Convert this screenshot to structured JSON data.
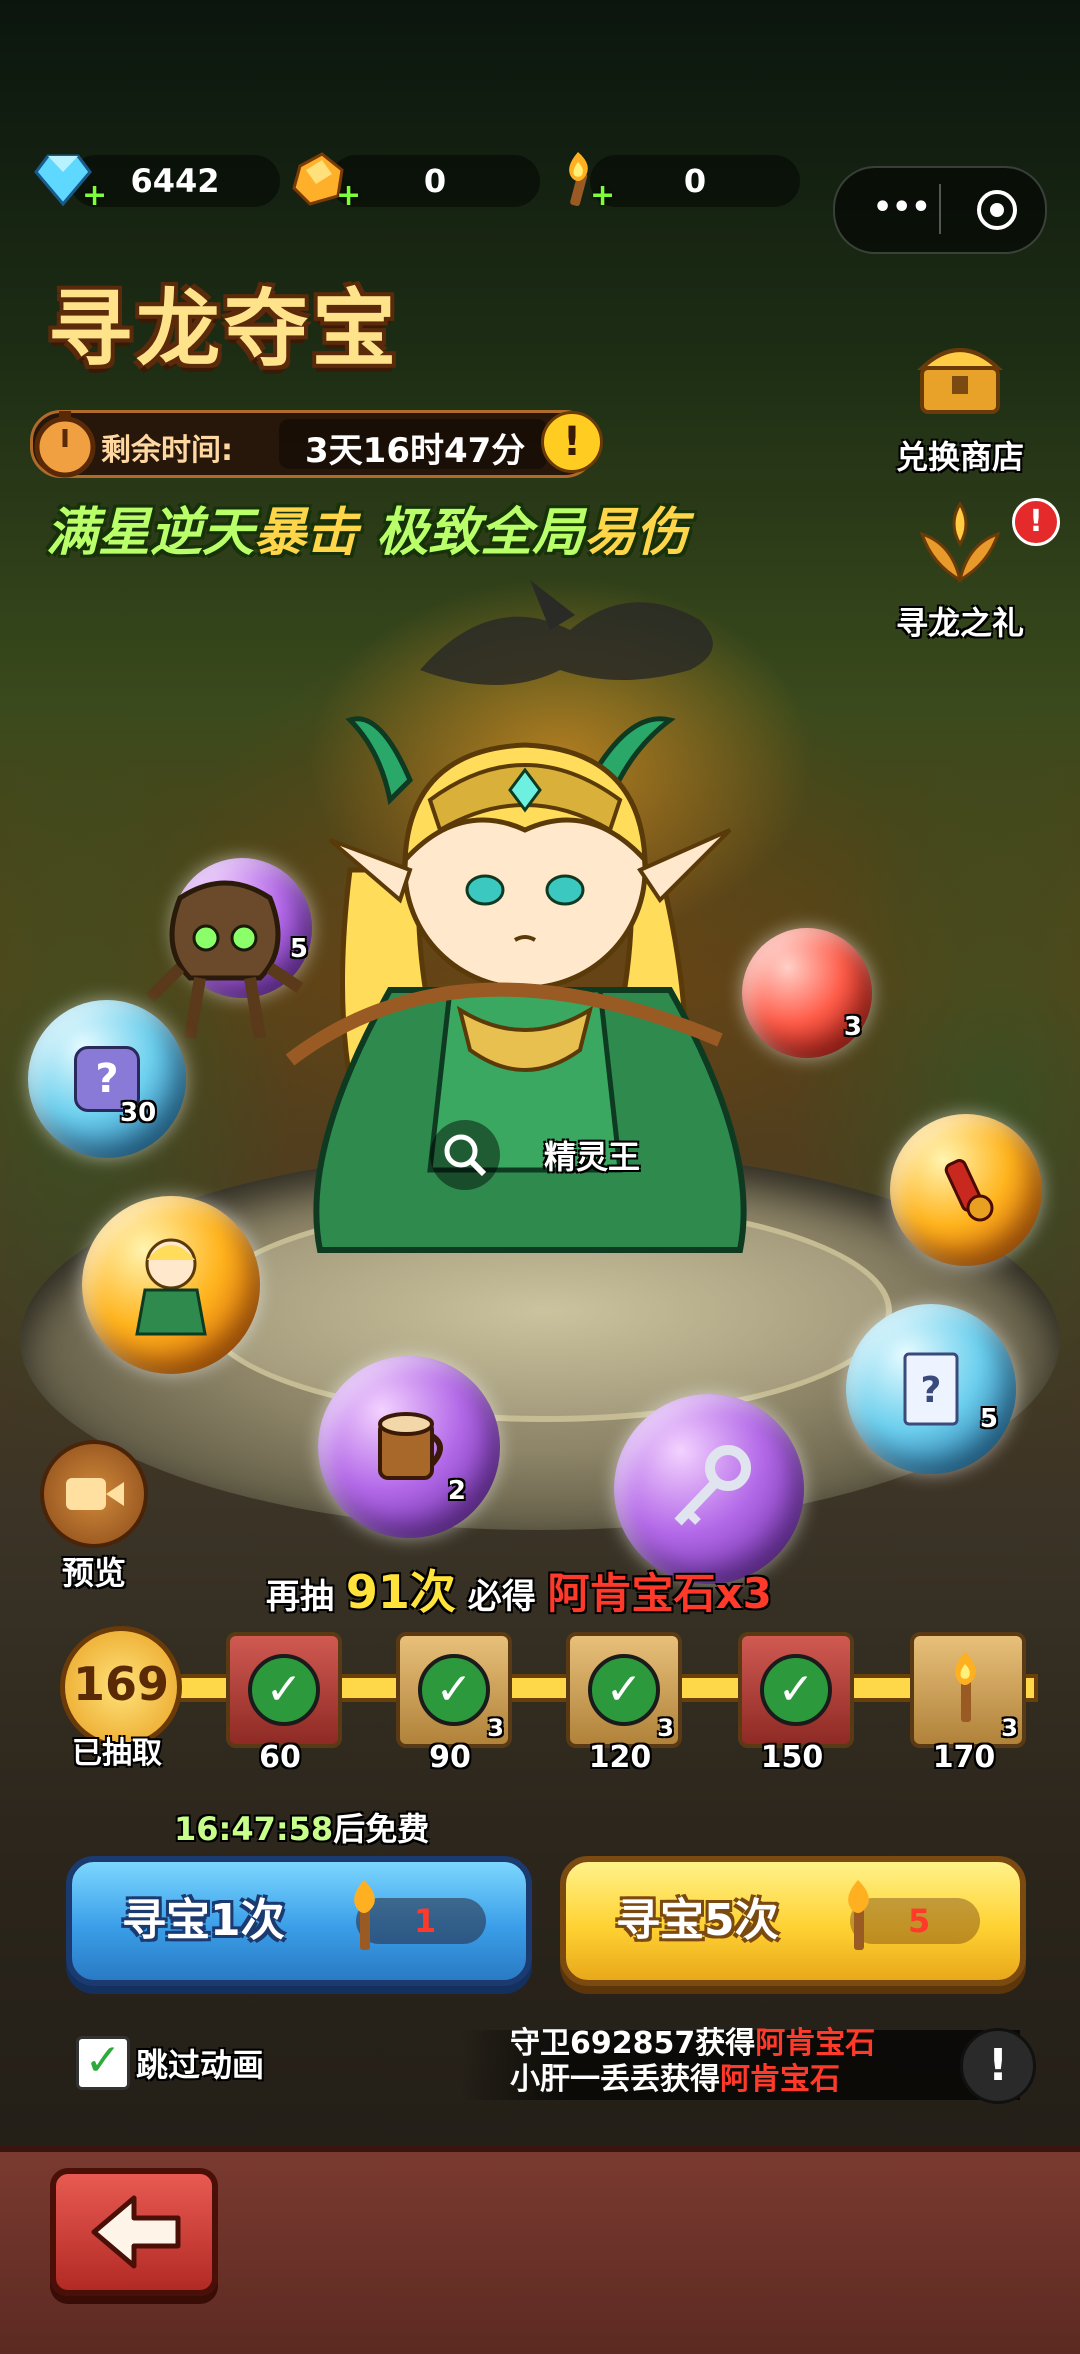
{
  "resources": [
    {
      "icon": "diamond-icon",
      "value": "6442"
    },
    {
      "icon": "gold-gem-icon",
      "value": "0"
    },
    {
      "icon": "torch-icon",
      "value": "0"
    }
  ],
  "menu_capsule": {
    "more_icon": "more-dots-icon",
    "close_icon": "target-close-icon"
  },
  "event": {
    "title": "寻龙夺宝",
    "time_label": "剩余时间:",
    "time_value": "3天16时47分",
    "slogan_a1": "满星逆天",
    "slogan_a2": "暴击",
    "slogan_b1": "极致全局",
    "slogan_b2": "易伤"
  },
  "side_buttons": {
    "exchange_shop": "兑换商店",
    "dragon_gift": "寻龙之礼"
  },
  "hero": {
    "name": "精灵王"
  },
  "preview_label": "预览",
  "orbs": {
    "groot_count": "5",
    "mystery_count": "30",
    "red_count": "3",
    "scroll_count": "5",
    "wood_count": "2"
  },
  "guarantee": {
    "pre": "再抽",
    "num": "91次",
    "mid": "必得",
    "reward": "阿肯宝石x3"
  },
  "progress": {
    "drawn_count": "169",
    "drawn_label": "已抽取",
    "milestones": [
      {
        "label": "60",
        "done": true,
        "count": ""
      },
      {
        "label": "90",
        "done": true,
        "count": "3"
      },
      {
        "label": "120",
        "done": true,
        "count": "3"
      },
      {
        "label": "150",
        "done": true,
        "count": ""
      },
      {
        "label": "170",
        "done": false,
        "count": "3"
      }
    ]
  },
  "free_timer": {
    "time": "16:47:58",
    "suffix": "后免费"
  },
  "draw_buttons": {
    "one": {
      "label": "寻宝1次",
      "cost": "1"
    },
    "five": {
      "label": "寻宝5次",
      "cost": "5"
    }
  },
  "skip_animation": {
    "label": "跳过动画",
    "checked": true
  },
  "broadcast": {
    "line1_name": "守卫692857获得",
    "line1_item": "阿肯宝石",
    "line2_name": "小肝一丢丢获得",
    "line2_item": "阿肯宝石"
  },
  "colors": {
    "accent_red": "#ff3a2a",
    "title_gold": "#ffe38a",
    "slogan_green": "#b8ff6a"
  }
}
